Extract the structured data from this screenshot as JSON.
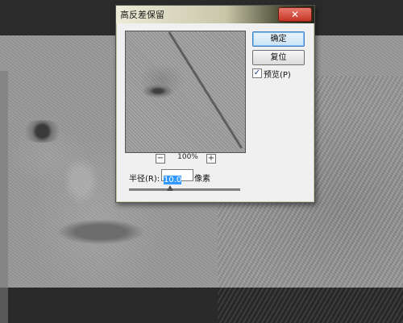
{
  "dialog": {
    "title": "高反差保留",
    "ok_label": "确定",
    "reset_label": "复位",
    "preview_label": "预览(P)",
    "preview_checked": true,
    "zoom_level": "100%",
    "zoom_minus": "−",
    "zoom_plus": "+",
    "radius_label": "半径(R):",
    "radius_value": "10.0",
    "radius_unit": "像素",
    "radius_slider_fraction": 0.37
  },
  "icons": {
    "close": "close-icon",
    "checkmark": "check-icon",
    "zoom_out": "minus-icon",
    "zoom_in": "plus-icon"
  },
  "colors": {
    "selection": "#3399ff",
    "close_button": "#c63426",
    "titlebar_dark": "#252719"
  }
}
